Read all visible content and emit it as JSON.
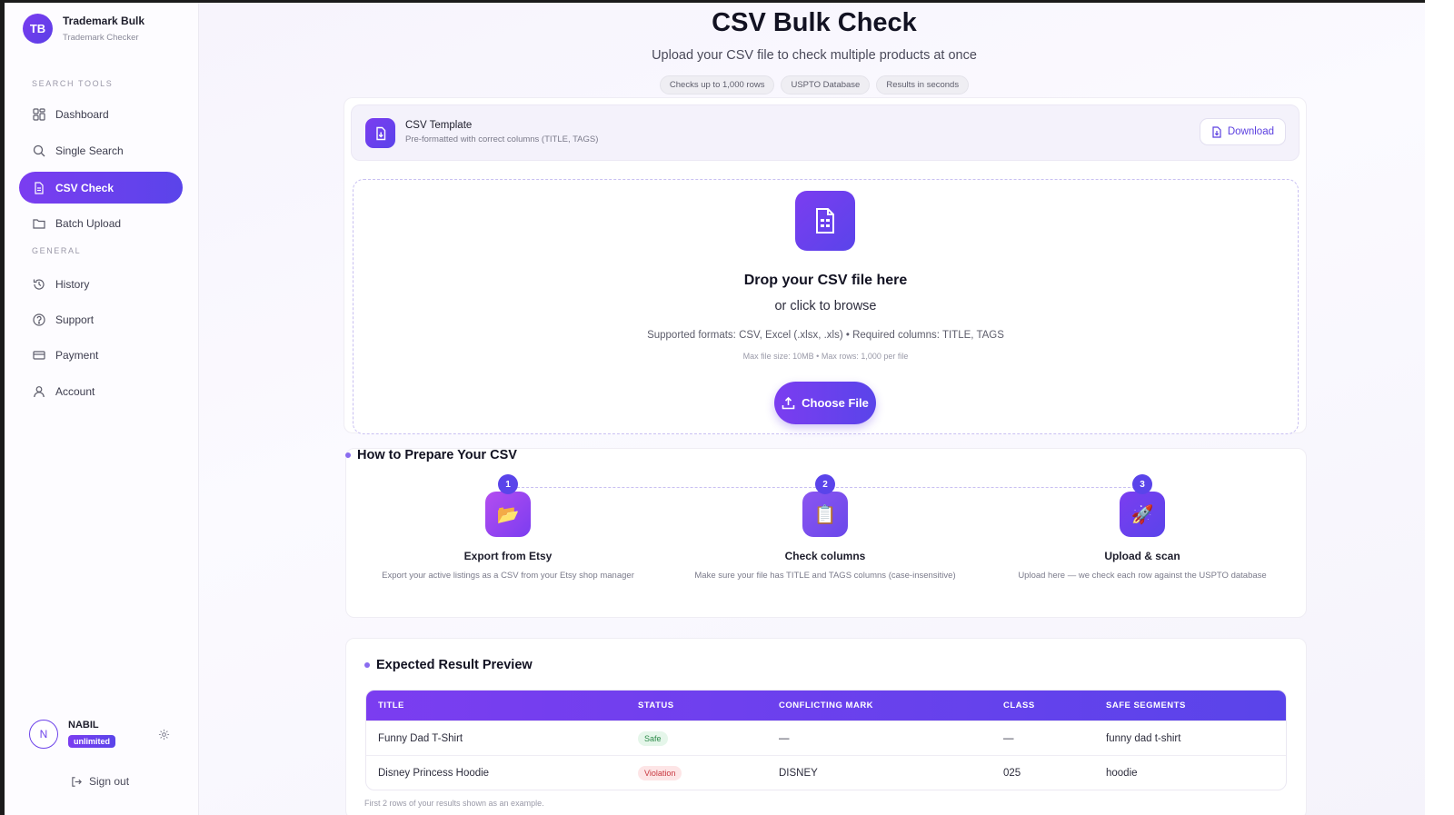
{
  "sidebar": {
    "brand_initials": "TB",
    "brand_title": "Trademark Bulk",
    "brand_subtitle": "Trademark Checker",
    "section_search": "SEARCH TOOLS",
    "section_general": "GENERAL",
    "items": [
      {
        "label": "Dashboard",
        "icon": "grid-icon"
      },
      {
        "label": "Single Search",
        "icon": "search-icon"
      },
      {
        "label": "CSV Check",
        "icon": "document-icon",
        "active": true
      },
      {
        "label": "Batch Upload",
        "icon": "folder-icon"
      },
      {
        "label": "History",
        "icon": "history-icon"
      },
      {
        "label": "Support",
        "icon": "help-icon"
      },
      {
        "label": "Payment",
        "icon": "credit-card-icon"
      },
      {
        "label": "Account",
        "icon": "user-icon"
      }
    ],
    "user": {
      "initial": "N",
      "name": "NABIL",
      "plan": "unlimited"
    },
    "sign_out": "Sign out"
  },
  "header": {
    "title": "CSV Bulk Check",
    "subtitle": "Upload your CSV file to check multiple products at once",
    "chips": [
      "Checks up to 1,000 rows",
      "USPTO Database",
      "Results in seconds"
    ]
  },
  "template": {
    "title": "CSV Template",
    "subtitle": "Pre-formatted with correct columns (TITLE, TAGS)",
    "download_label": "Download"
  },
  "dropzone": {
    "title": "Drop your CSV file here",
    "subtitle": "or click to browse",
    "formats": "Supported formats: CSV, Excel (.xlsx, .xls) • Required columns: TITLE, TAGS",
    "limits": "Max file size: 10MB • Max rows: 1,000 per file",
    "button_label": "Choose File"
  },
  "prepare": {
    "title": "How to Prepare Your CSV",
    "steps": [
      {
        "num": "1",
        "icon": "📂",
        "title": "Export from Etsy",
        "desc": "Export your active listings as a CSV from your Etsy shop manager"
      },
      {
        "num": "2",
        "icon": "📋",
        "title": "Check columns",
        "desc": "Make sure your file has TITLE and TAGS columns (case-insensitive)"
      },
      {
        "num": "3",
        "icon": "🚀",
        "title": "Upload & scan",
        "desc": "Upload here — we check each row against the USPTO database"
      }
    ]
  },
  "preview": {
    "title": "Expected Result Preview",
    "columns": [
      "TITLE",
      "STATUS",
      "CONFLICTING MARK",
      "CLASS",
      "SAFE SEGMENTS"
    ],
    "rows": [
      {
        "title": "Funny Dad T-Shirt",
        "status": "Safe",
        "mark": "—",
        "class": "—",
        "segments": "funny dad t-shirt"
      },
      {
        "title": "Disney Princess Hoodie",
        "status": "Violation",
        "mark": "DISNEY",
        "class": "025",
        "segments": "hoodie"
      }
    ],
    "note": "First 2 rows of your results shown as an example."
  },
  "colors": {
    "accent": "#6d43ea",
    "safe": "#2e8b4a",
    "violation": "#c8373f"
  }
}
